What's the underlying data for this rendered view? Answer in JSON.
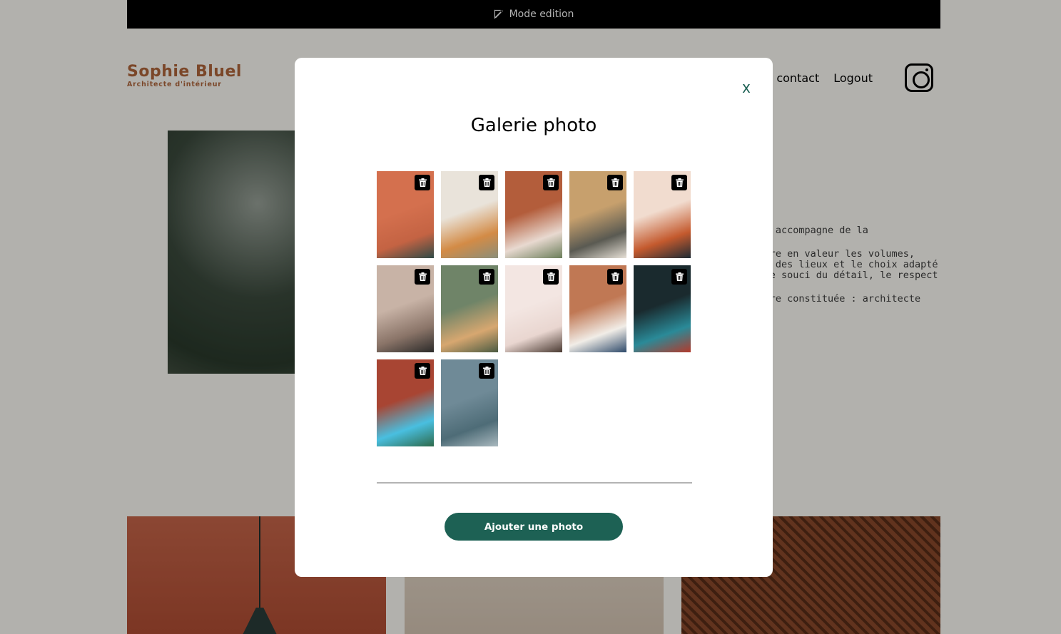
{
  "edit_bar": {
    "label": "Mode edition",
    "icon": "edit-icon"
  },
  "logo": {
    "title": "Sophie Bluel",
    "subtitle": "Architecte d'intérieur"
  },
  "nav": {
    "partial_link": "s",
    "contact": "contact",
    "logout": "Logout",
    "instagram_icon": "instagram-icon"
  },
  "intro": {
    "lines": [
      "e vous accompagne de la",
      "à mettre en valeur les volumes, esprit des lieux et le choix adapté dans le souci du détail, le respect",
      "eut-être constituée : architecte"
    ]
  },
  "modal": {
    "title": "Galerie photo",
    "close": "x",
    "add_button": "Ajouter une photo",
    "photos": [
      {
        "subject": "orange wall pendant lamp",
        "colors": [
          "#D4704E",
          "#C46343",
          "#2F4A46"
        ]
      },
      {
        "subject": "living room with plants",
        "colors": [
          "#E9E3DA",
          "#D38B46",
          "#8A8E7A"
        ]
      },
      {
        "subject": "restaurant wooden ceiling",
        "colors": [
          "#B35D3B",
          "#E8D9D0",
          "#6B7E5A"
        ]
      },
      {
        "subject": "wooden screen lounge",
        "colors": [
          "#C7A06D",
          "#5A5A52",
          "#E6E0D6"
        ]
      },
      {
        "subject": "arched shapes",
        "colors": [
          "#F1DCCF",
          "#C45A2E",
          "#1D2A33"
        ]
      },
      {
        "subject": "minimal kitchen",
        "colors": [
          "#C8B3A6",
          "#8A7468",
          "#2B2A29"
        ]
      },
      {
        "subject": "green living room",
        "colors": [
          "#6F8468",
          "#D7A770",
          "#4B5B42"
        ]
      },
      {
        "subject": "white arch room",
        "colors": [
          "#F3E6E2",
          "#E9D6D0",
          "#4A3A32"
        ]
      },
      {
        "subject": "terracotta bedroom",
        "colors": [
          "#C07854",
          "#F1EDE7",
          "#2E4A6B"
        ]
      },
      {
        "subject": "teal bar counter",
        "colors": [
          "#1A2A2E",
          "#2A8A98",
          "#B33A2C"
        ]
      },
      {
        "subject": "long restaurant hall",
        "colors": [
          "#A84533",
          "#49BFE0",
          "#2E6A4B"
        ]
      },
      {
        "subject": "coastal cliff",
        "colors": [
          "#6F8A97",
          "#4E6C77",
          "#A9B8BE"
        ]
      }
    ]
  },
  "colors": {
    "accent": "#1D6154",
    "brand": "#B1663C"
  }
}
